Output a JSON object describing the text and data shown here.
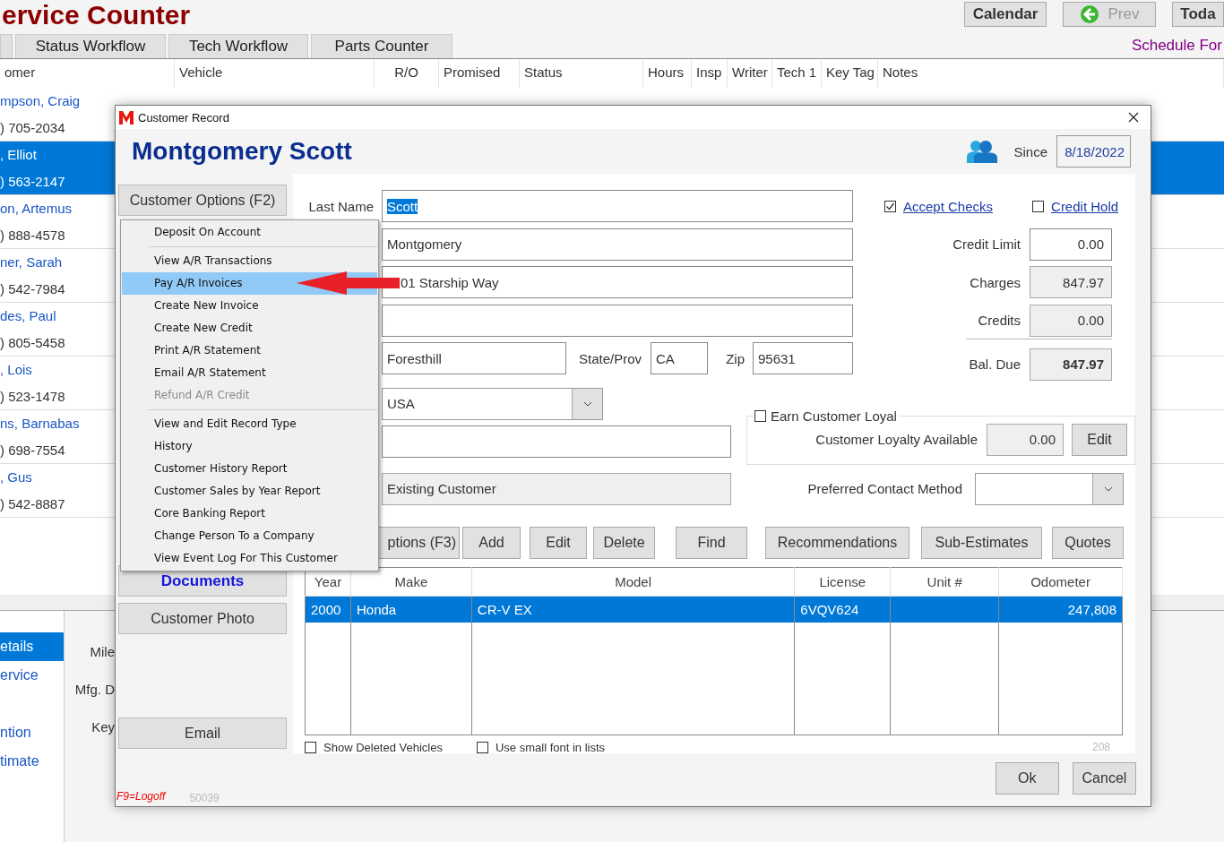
{
  "app": {
    "title": "ervice Counter",
    "toolbar_buttons": [
      {
        "label": "Calendar",
        "kind": "plain",
        "disabled": false
      },
      {
        "label": "Prev",
        "kind": "back",
        "disabled": true
      },
      {
        "label": "Toda",
        "kind": "plain",
        "disabled": false
      }
    ],
    "tabs": [
      {
        "label": "Status Workflow",
        "selected": false
      },
      {
        "label": "Tech Workflow",
        "selected": false
      },
      {
        "label": "Parts Counter",
        "selected": false
      }
    ],
    "schedule_link": "Schedule For",
    "columns": [
      "omer",
      "Vehicle",
      "R/O",
      "Promised",
      "Status",
      "Hours",
      "Insp",
      "Writer",
      "Tech 1",
      "Key Tag",
      "Notes"
    ],
    "rows": [
      {
        "customer": "mpson, Craig",
        "phone": ") 705-2034",
        "selected": false,
        "cells": []
      },
      {
        "customer": ", Elliot",
        "phone": ") 563-2147",
        "selected": true,
        "cells": []
      },
      {
        "customer": "on, Artemus",
        "phone": ") 888-4578",
        "selected": false,
        "cells": []
      },
      {
        "customer": "ner, Sarah",
        "phone": ") 542-7984",
        "selected": false,
        "cells": []
      },
      {
        "customer": "des, Paul",
        "phone": ") 805-5458",
        "selected": false,
        "cells": []
      },
      {
        "customer": ", Lois",
        "phone": ") 523-1478",
        "selected": false,
        "cells": []
      },
      {
        "customer": "ns, Barnabas",
        "phone": ") 698-7554",
        "selected": false,
        "cells": []
      },
      {
        "customer": ", Gus",
        "phone": ") 542-8887",
        "selected": false,
        "cells": []
      }
    ],
    "detail_nav": [
      {
        "label": "etails",
        "selected": true
      },
      {
        "label": "ervice",
        "selected": false
      },
      {
        "label": "ntion",
        "selected": false
      },
      {
        "label": "timate",
        "selected": false
      }
    ],
    "detail_labels": [
      "Mile",
      "Mfg. D",
      "Key"
    ]
  },
  "dialog": {
    "title": "Customer Record",
    "customer_name": "Montgomery Scott",
    "since_label": "Since",
    "since_value": "8/18/2022",
    "options_button": "Customer Options (F2)",
    "documents_button": "Documents",
    "photo_button": "Customer Photo",
    "email_button": "Email",
    "logoff_hint": "F9=Logoff",
    "record_number": "50039",
    "last_name": {
      "label": "Last Name",
      "value": "Scott",
      "value_selected": true
    },
    "first_name": {
      "value": "Montgomery"
    },
    "address": {
      "value": "01 Starship Way"
    },
    "city": {
      "value": "Foresthill"
    },
    "state": {
      "label": "State/Prov",
      "value": "CA"
    },
    "zip": {
      "label": "Zip",
      "value": "95631"
    },
    "country": {
      "value": "USA"
    },
    "customer_type": {
      "value": "Existing Customer"
    },
    "flags": [
      {
        "label": "Accept Checks",
        "checked": true
      },
      {
        "label": "Credit Hold",
        "checked": false
      }
    ],
    "amounts": [
      {
        "label": "Credit Limit",
        "value": "0.00",
        "disabled": false,
        "kind": "amount"
      },
      {
        "label": "Charges",
        "value": "847.97",
        "disabled": true,
        "kind": "amount"
      },
      {
        "label": "Credits",
        "value": "0.00",
        "disabled": true,
        "kind": "amount"
      },
      {
        "label": "Bal. Due",
        "value": "847.97",
        "disabled": true,
        "kind": "total"
      }
    ],
    "loyalty": {
      "label": "Earn Customer Loyal",
      "checked": false,
      "available_label": "Customer Loyalty Available",
      "available_value": "0.00",
      "edit_button": "Edit"
    },
    "contact_method": {
      "label": "Preferred Contact Method"
    },
    "action_buttons": [
      "ptions (F3)",
      "Add",
      "Edit",
      "Delete",
      "Find",
      "Recommendations",
      "Sub-Estimates",
      "Quotes"
    ],
    "vehicle_columns": [
      "Year",
      "Make",
      "Model",
      "License",
      "Unit #",
      "Odometer"
    ],
    "vehicles": [
      {
        "cells": [
          "2000",
          "Honda",
          "CR-V EX",
          "6VQV624",
          null,
          "247,808"
        ],
        "selected": true
      }
    ],
    "list_options": [
      {
        "label": "Show Deleted Vehicles",
        "checked": false
      },
      {
        "label": "Use small font in lists",
        "checked": false
      }
    ],
    "vehicle_count": "208",
    "footer_buttons": [
      "Ok",
      "Cancel"
    ],
    "menu": {
      "groups": [
        [
          {
            "label": "Deposit On Account",
            "selected": false,
            "disabled": false
          }
        ],
        [
          {
            "label": "View A/R Transactions",
            "selected": false,
            "disabled": false
          },
          {
            "label": "Pay A/R Invoices",
            "selected": true,
            "disabled": false
          },
          {
            "label": "Create New Invoice",
            "selected": false,
            "disabled": false
          },
          {
            "label": "Create New Credit",
            "selected": false,
            "disabled": false
          },
          {
            "label": "Print A/R Statement",
            "selected": false,
            "disabled": false
          },
          {
            "label": "Email A/R Statement",
            "selected": false,
            "disabled": false
          },
          {
            "label": "Refund A/R Credit",
            "selected": false,
            "disabled": true
          }
        ],
        [
          {
            "label": "View and Edit Record Type",
            "selected": false,
            "disabled": false
          },
          {
            "label": "History",
            "selected": false,
            "disabled": false
          },
          {
            "label": "Customer History Report",
            "selected": false,
            "disabled": false
          },
          {
            "label": "Customer Sales by Year Report",
            "selected": false,
            "disabled": false
          },
          {
            "label": "Core Banking Report",
            "selected": false,
            "disabled": false
          },
          {
            "label": "Change Person To a Company",
            "selected": false,
            "disabled": false
          },
          {
            "label": "View Event Log For This Customer",
            "selected": false,
            "disabled": false
          }
        ]
      ]
    }
  }
}
